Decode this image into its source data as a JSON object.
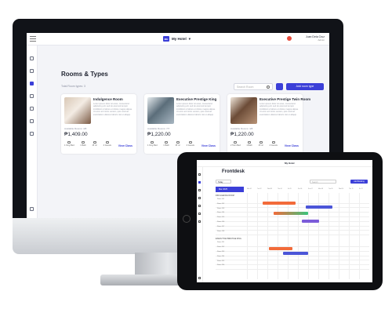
{
  "desktop": {
    "hotel_name": "My Hotel",
    "hotel_logo_text": "MH",
    "user": {
      "name": "Juan Dela Cruz",
      "role": "Admin"
    },
    "page_title": "Rooms & Types",
    "total_label": "Total Room types: 3",
    "search_placeholder": "Search Room",
    "add_button": "Add room type",
    "cards": [
      {
        "name": "Indulgence Room",
        "description": "Lorem ipsum dolor sit amet, consectetur adipiscing elit, sed do eiusmod tempor incididunt ut labore et dolore magna aliqua. Ut enim ad minim veniam, quis nostrud exercitation ullamco laboris nisi ut aliquip.",
        "available": "Available Rooms: 4/8",
        "price": "₱1,409.00",
        "features": [
          "1 King Bed",
          "1 Bath",
          "15 m²",
          "4 Guests"
        ],
        "view": "View Class",
        "image_colors": [
          "#7b5a44",
          "#d9c8b6",
          "#f3ece4"
        ]
      },
      {
        "name": "Executive Prestige King",
        "description": "Lorem ipsum dolor sit amet, consectetur adipiscing elit, sed do eiusmod tempor incididunt ut labore et dolore magna aliqua. Ut enim ad minim veniam, quis nostrud exercitation ullamco laboris nisi ut aliquip.",
        "available": "Available Rooms: 7/7",
        "price": "₱1,220.00",
        "features": [
          "1 King Bed",
          "1 Bath",
          "15 m²",
          "4 Guests"
        ],
        "view": "View Class",
        "image_colors": [
          "#a8b7c2",
          "#e6ecef",
          "#5b6d7a"
        ]
      },
      {
        "name": "Executive Prestige Twin Room",
        "description": "Lorem ipsum dolor sit amet, consectetur adipiscing elit, sed do eiusmod tempor incididunt ut labore et dolore magna aliqua. Ut enim ad minim veniam, quis nostrud exercitation ullamco laboris nisi ut aliquip.",
        "available": "Available Rooms: 4/8",
        "price": "₱1,220.00",
        "features": [
          "2 Twin Bed",
          "1 Bath",
          "15 m²",
          "4 Guests"
        ],
        "view": "View Class",
        "image_colors": [
          "#b89377",
          "#f0e6da",
          "#6c4c37"
        ]
      }
    ]
  },
  "tablet": {
    "hotel_name": "My Hotel",
    "page_title": "Frontdesk",
    "date_pill": "Today",
    "search_placeholder": "Search",
    "new_button": "Add Booking",
    "month_label": "Mar 2025",
    "days": [
      "Mon 01",
      "Tue 02",
      "Wed 03",
      "Thu 04",
      "Fri 05",
      "Sat 06",
      "Sun 07",
      "Mon 08",
      "Tue 09",
      "Wed 10",
      "Thu 11",
      "Fri 12"
    ],
    "groups": [
      {
        "name": "INDULGENCE ROOM",
        "rooms": [
          "Room 101",
          "Room 102",
          "Room 103",
          "Room 104",
          "Room 105",
          "Room 106",
          "Room 107",
          "Room 108"
        ]
      },
      {
        "name": "EXECUTIVE PRESTIGE KING",
        "rooms": [
          "Room 201",
          "Room 202",
          "Room 203",
          "Room 204",
          "Room 205",
          "Room 206"
        ]
      }
    ],
    "colors": {
      "orange": "#f26b3a",
      "green": "#3ac47d",
      "indigo": "#4b55d8",
      "purple": "#7b5bd9"
    }
  },
  "accent": "#3b3fd8"
}
